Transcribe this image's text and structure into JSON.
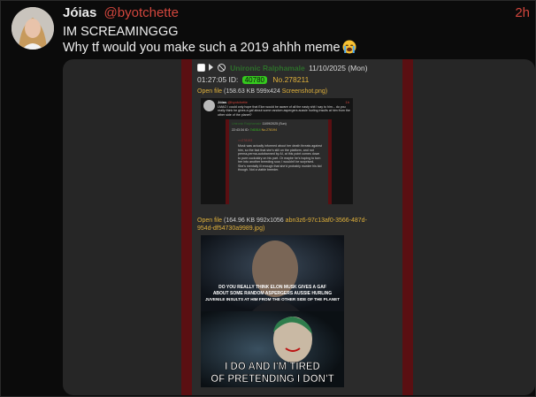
{
  "post": {
    "display_name": "Jóias",
    "handle": "@byotchette",
    "time": "2h",
    "line1": "IM SCREAMINGGG",
    "line2": "Why tf would you make such a 2019 ahhh meme",
    "emoji": "loudly-crying-face-emoji"
  },
  "chan_post": {
    "poster_name": "Unironic Ralphamale",
    "date": "11/10/2025 (Mon)",
    "time": "01:27:05",
    "id_label": "ID:",
    "id_value": "40780",
    "post_number": "No.278211",
    "file1_prefix": "Open file",
    "file1_meta": "(158.63 KB 599x424",
    "file1_name": "Screenshot.png)",
    "file2_prefix": "Open file",
    "file2_meta": "(164.96 KB 992x1056",
    "file2_name": "abn3z6-97c13af0-3566-487d-954d-df54730a9989.jpg)"
  },
  "screenshot": {
    "name": "Jóias",
    "handle": "@byotchette",
    "time": "1h",
    "text": "LMAO I could only hope that Elon would be aware of all the nasty shit I say to him... do you really think he gives a gaf about some random aspergers aussie hurling insults at him from the other side of the planet?",
    "inner_name": "Unironic Ralphamale",
    "inner_date": "11/09/2025 (Sun)",
    "inner_time": "22:43:34 ID:",
    "inner_id": "7d1514",
    "inner_no": "No.278194",
    "quote": ">>278193",
    "body": "Musk was actually informed about her death threats against him, so the fact that she's still on the platform, and not perma-perma-autobanned by AI, at this point comes down to pure cuckoldry on his part. Or maybe he's hoping to turn her into another breeding sow, I wouldn't be surprised. She's mentally ill enough that she'd probably murder his kid though. Not a viable breeder."
  },
  "meme": {
    "top_caption_1": "DO YOU REALLY THINK ELON MUSK GIVES A GAF",
    "top_caption_2": "ABOUT SOME RANDOM ASPERGERS AUSSIE HURLING",
    "top_caption_3": "JUVENILE INSULTS AT HIM FROM THE OTHER SIDE OF THE PLANET",
    "bottom_caption_1": "I DO AND I'M TIRED",
    "bottom_caption_2": "OF PRETENDING I DON'T"
  }
}
